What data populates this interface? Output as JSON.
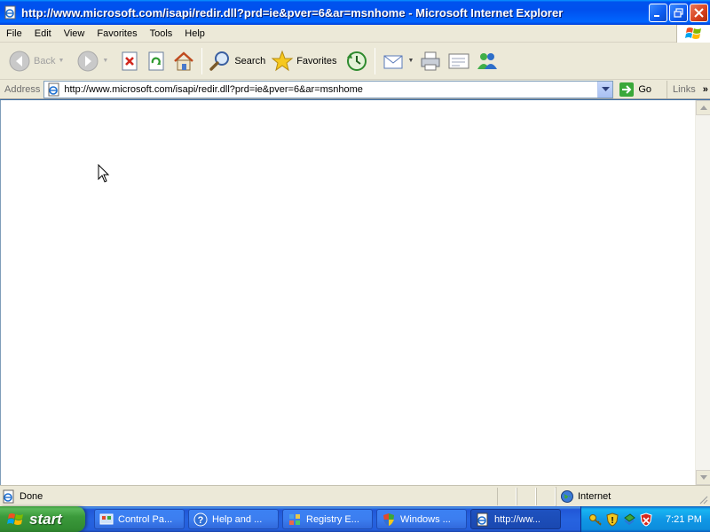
{
  "window": {
    "title": "http://www.microsoft.com/isapi/redir.dll?prd=ie&pver=6&ar=msnhome - Microsoft Internet Explorer"
  },
  "menu": [
    "File",
    "Edit",
    "View",
    "Favorites",
    "Tools",
    "Help"
  ],
  "toolbar": {
    "back_label": "Back",
    "search_label": "Search",
    "favorites_label": "Favorites"
  },
  "address": {
    "label": "Address",
    "url": "http://www.microsoft.com/isapi/redir.dll?prd=ie&pver=6&ar=msnhome",
    "go_label": "Go",
    "links_label": "Links"
  },
  "status": {
    "text": "Done",
    "zone": "Internet"
  },
  "taskbar": {
    "start_label": "start",
    "items": [
      {
        "label": "Control Pa...",
        "icon": "control-panel-icon"
      },
      {
        "label": "Help and ...",
        "icon": "help-icon"
      },
      {
        "label": "Registry E...",
        "icon": "registry-icon"
      },
      {
        "label": "Windows ...",
        "icon": "security-shield-icon"
      },
      {
        "label": "http://ww...",
        "icon": "ie-page-icon"
      }
    ],
    "clock": "7:21 PM"
  },
  "colors": {
    "titlebar": "#0054e3",
    "menubar": "#ece9d8",
    "start_green": "#3c9a3c",
    "taskbar_blue": "#245edb"
  }
}
